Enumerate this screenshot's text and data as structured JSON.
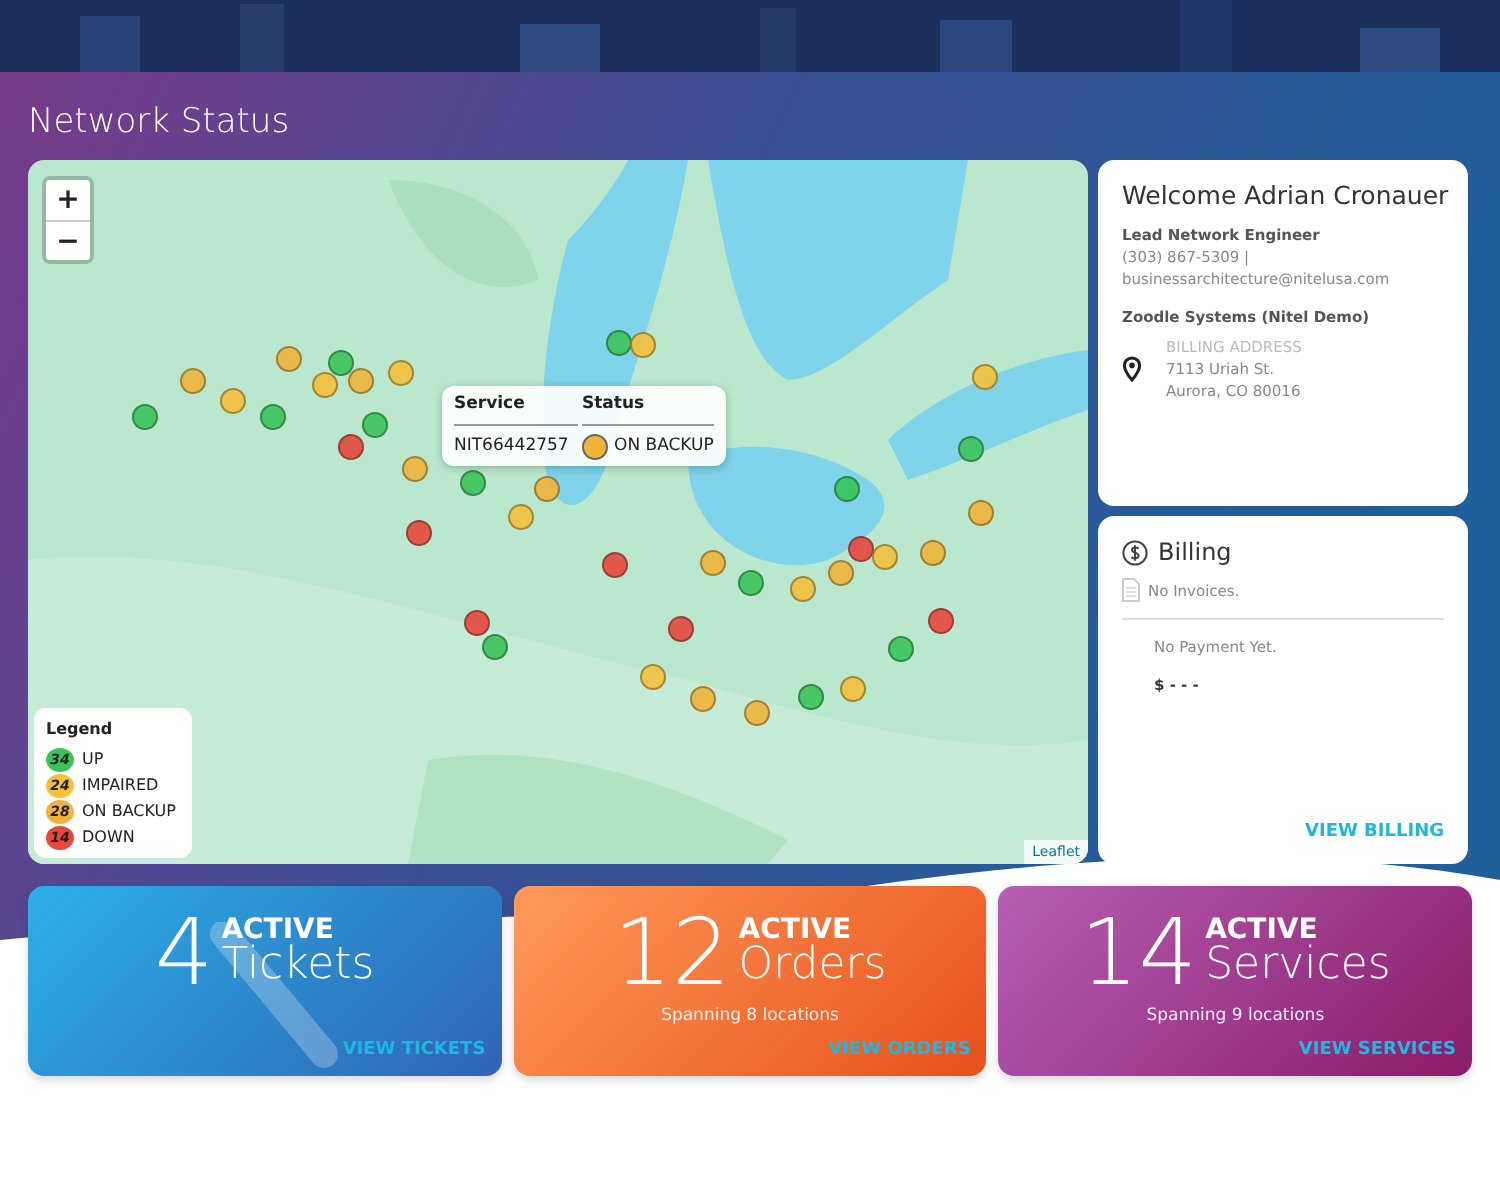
{
  "page_title": "Network Status",
  "map": {
    "zoom_in": "+",
    "zoom_out": "−",
    "attribution": "Leaflet",
    "tooltip": {
      "headers": [
        "Service",
        "Status"
      ],
      "service": "NIT66442757",
      "status": "ON BACKUP",
      "color": "#f0b43a"
    },
    "legend": {
      "title": "Legend",
      "items": [
        {
          "kind": "up",
          "count": "34",
          "label": "UP",
          "color": "#3cc45a"
        },
        {
          "kind": "impaired",
          "count": "24",
          "label": "IMPAIRED",
          "color": "#f5c13c"
        },
        {
          "kind": "backup",
          "count": "28",
          "label": "ON BACKUP",
          "color": "#f0b43a"
        },
        {
          "kind": "down",
          "count": "14",
          "label": "DOWN",
          "color": "#e8473c"
        }
      ]
    },
    "markers": [
      {
        "kind": "up"
      },
      {
        "kind": "backup"
      },
      {
        "kind": "impaired"
      },
      {
        "kind": "up"
      },
      {
        "kind": "backup"
      },
      {
        "kind": "up"
      },
      {
        "kind": "impaired"
      },
      {
        "kind": "backup"
      },
      {
        "kind": "down"
      },
      {
        "kind": "up"
      },
      {
        "kind": "impaired"
      },
      {
        "kind": "backup"
      },
      {
        "kind": "up"
      },
      {
        "kind": "down"
      },
      {
        "kind": "impaired"
      },
      {
        "kind": "backup"
      },
      {
        "kind": "up"
      },
      {
        "kind": "impaired"
      },
      {
        "kind": "down"
      },
      {
        "kind": "backup"
      },
      {
        "kind": "up"
      },
      {
        "kind": "impaired"
      },
      {
        "kind": "backup"
      },
      {
        "kind": "up"
      },
      {
        "kind": "down"
      },
      {
        "kind": "impaired"
      },
      {
        "kind": "up"
      },
      {
        "kind": "backup"
      },
      {
        "kind": "down"
      },
      {
        "kind": "up"
      },
      {
        "kind": "impaired"
      },
      {
        "kind": "backup"
      },
      {
        "kind": "up"
      },
      {
        "kind": "down"
      },
      {
        "kind": "impaired"
      },
      {
        "kind": "backup"
      },
      {
        "kind": "up"
      },
      {
        "kind": "impaired"
      },
      {
        "kind": "down"
      },
      {
        "kind": "backup"
      }
    ]
  },
  "welcome": {
    "title": "Welcome Adrian Cronauer",
    "role": "Lead Network Engineer",
    "phone": "(303) 867-5309 |",
    "email": "businessarchitecture@nitelusa.com",
    "company": "Zoodle Systems (Nitel Demo)",
    "address_label": "BILLING ADDRESS",
    "address_lines": [
      "7113 Uriah St.",
      "Aurora, CO 80016"
    ]
  },
  "billing": {
    "title": "Billing",
    "invoices": "No Invoices.",
    "payment": "No Payment Yet.",
    "amount": "$ - - -",
    "link": "VIEW BILLING"
  },
  "tiles": [
    {
      "kind": "tickets",
      "count": "4",
      "prefix": "ACTIVE",
      "noun": "Tickets",
      "link": "VIEW TICKETS"
    },
    {
      "kind": "orders",
      "count": "12",
      "prefix": "ACTIVE",
      "noun": "Orders",
      "sub": "Spanning 8 locations",
      "link": "VIEW ORDERS"
    },
    {
      "kind": "services",
      "count": "14",
      "prefix": "ACTIVE",
      "noun": "Services",
      "sub": "Spanning 9 locations",
      "link": "VIEW SERVICES"
    }
  ]
}
